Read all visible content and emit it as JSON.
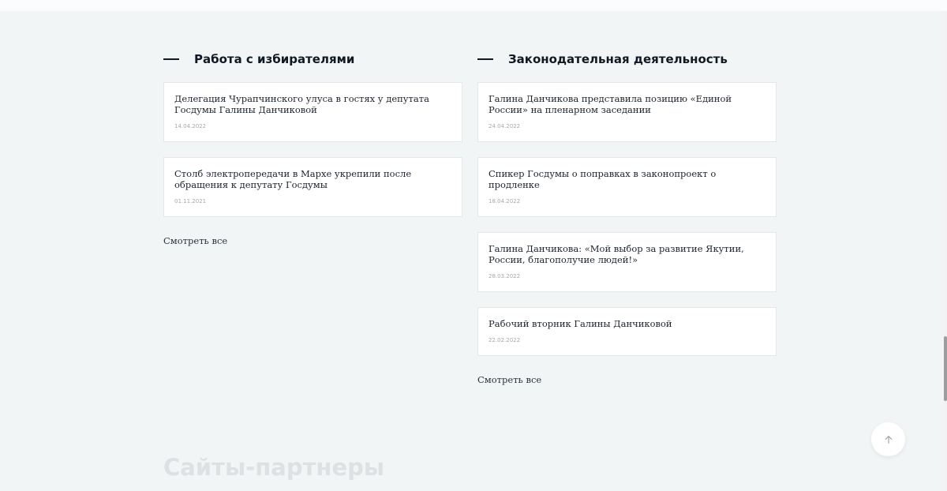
{
  "sections": [
    {
      "title": "Работа с избирателями",
      "cards": [
        {
          "text": "Делегация Чурапчинского улуса в гостях у депутата Госдумы Галины Данчиковой",
          "date": "14.04.2022"
        },
        {
          "text": "Столб электропередачи в Мархе укрепили после обращения к депутату  Госдумы",
          "date": "01.11.2021"
        }
      ],
      "see_all": "Смотреть все"
    },
    {
      "title": "Законодательная деятельность",
      "cards": [
        {
          "text": "Галина Данчикова представила позицию «Единой России» на пленарном заседании",
          "date": "24.04.2022"
        },
        {
          "text": "Спикер Госдумы о поправках в законопроект о продленке",
          "date": "18.04.2022"
        },
        {
          "text": "Галина Данчикова: «Мой выбор за развитие Якутии, России, благополучие людей!»",
          "date": "28.03.2022"
        },
        {
          "text": "Рабочий вторник Галины Данчиковой",
          "date": "22.02.2022"
        }
      ],
      "see_all": "Смотреть все"
    }
  ],
  "partners": {
    "heading": "Сайты-партнеры"
  },
  "scroll_top": {
    "icon": "arrow-up-icon"
  },
  "colors": {
    "background": "#f2f5f6",
    "card": "#ffffff",
    "heading": "#101923",
    "muted_date": "#a3a9ae",
    "partners_heading": "#dde1e3"
  }
}
